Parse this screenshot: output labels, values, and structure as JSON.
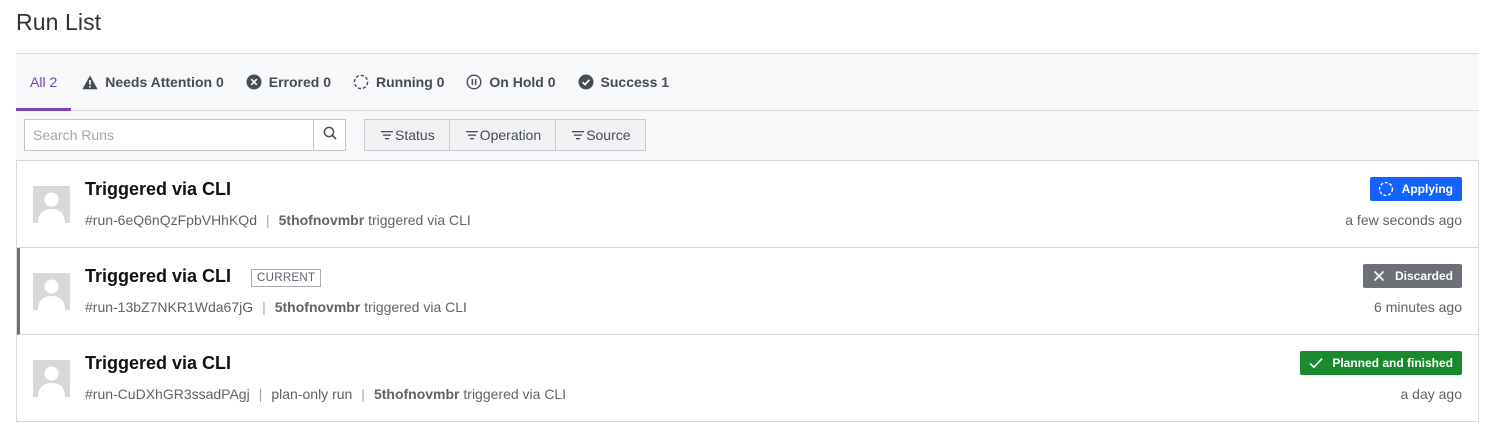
{
  "page": {
    "title": "Run List"
  },
  "tabs": [
    {
      "label": "All 2",
      "icon": "",
      "active": true
    },
    {
      "label": "Needs Attention 0",
      "icon": "warning-icon"
    },
    {
      "label": "Errored 0",
      "icon": "x-circle-icon"
    },
    {
      "label": "Running 0",
      "icon": "spinner-icon"
    },
    {
      "label": "On Hold 0",
      "icon": "pause-circle-icon"
    },
    {
      "label": "Success 1",
      "icon": "check-circle-icon"
    }
  ],
  "search": {
    "placeholder": "Search Runs",
    "value": "",
    "icon": "search-icon"
  },
  "filters": [
    {
      "label": "Status",
      "icon": "filter-icon"
    },
    {
      "label": "Operation",
      "icon": "filter-icon"
    },
    {
      "label": "Source",
      "icon": "filter-icon"
    }
  ],
  "runs": [
    {
      "title": "Triggered via CLI",
      "badge": "",
      "id": "#run-6eQ6nQzFpbVHhKQd",
      "extra": "",
      "user": "5thofnovmbr",
      "trigger": "triggered via CLI",
      "status": "Applying",
      "status_color": "#1563ff",
      "status_icon": "spinner-icon",
      "time": "a few seconds ago"
    },
    {
      "title": "Triggered via CLI",
      "badge": "CURRENT",
      "id": "#run-13bZ7NKR1Wda67jG",
      "extra": "",
      "user": "5thofnovmbr",
      "trigger": "triggered via CLI",
      "status": "Discarded",
      "status_color": "#6c6f76",
      "status_icon": "close-icon",
      "time": "6 minutes ago"
    },
    {
      "title": "Triggered via CLI",
      "badge": "",
      "id": "#run-CuDXhGR3ssadPAgj",
      "extra": "plan-only run",
      "user": "5thofnovmbr",
      "trigger": "triggered via CLI",
      "status": "Planned and finished",
      "status_color": "#1a8a2f",
      "status_icon": "check-icon",
      "time": "a day ago"
    }
  ],
  "colors": {
    "accent": "#7b42bc",
    "border": "#d7d9dd",
    "muted": "#5f6369"
  }
}
